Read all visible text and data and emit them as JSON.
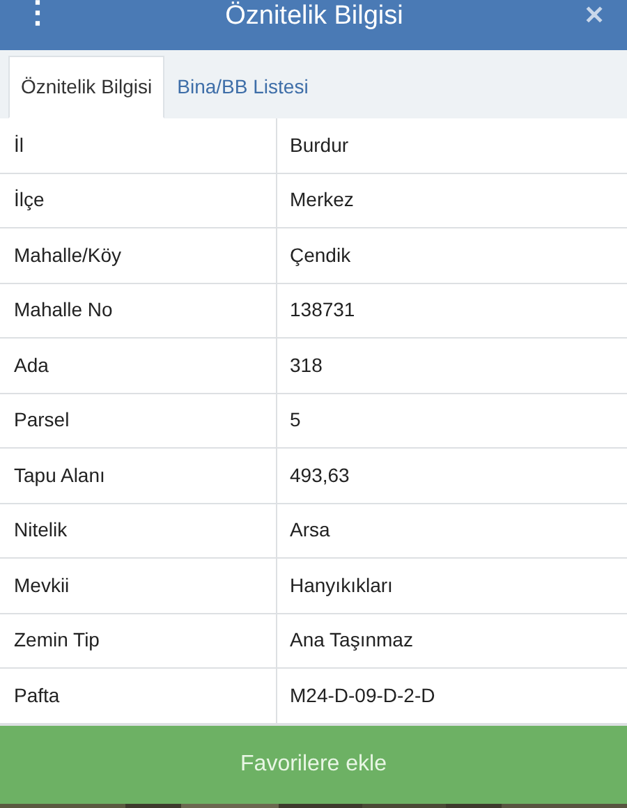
{
  "header": {
    "title": "Öznitelik Bilgisi",
    "menu_icon": "⋮",
    "close_icon": "✕"
  },
  "tabs": [
    {
      "label": "Öznitelik Bilgisi",
      "selected": true
    },
    {
      "label": "Bina/BB Listesi",
      "selected": false
    }
  ],
  "table": {
    "rows": [
      {
        "label": "İl",
        "value": "Burdur"
      },
      {
        "label": "İlçe",
        "value": "Merkez"
      },
      {
        "label": "Mahalle/Köy",
        "value": "Çendik"
      },
      {
        "label": "Mahalle No",
        "value": "138731"
      },
      {
        "label": "Ada",
        "value": "318"
      },
      {
        "label": "Parsel",
        "value": "5"
      },
      {
        "label": "Tapu Alanı",
        "value": "493,63"
      },
      {
        "label": "Nitelik",
        "value": "Arsa"
      },
      {
        "label": "Mevkii",
        "value": "Hanyıkıkları"
      },
      {
        "label": "Zemin Tip",
        "value": "Ana Taşınmaz"
      },
      {
        "label": "Pafta",
        "value": "M24-D-09-D-2-D"
      }
    ]
  },
  "button": {
    "label": "Favorilere ekle"
  }
}
